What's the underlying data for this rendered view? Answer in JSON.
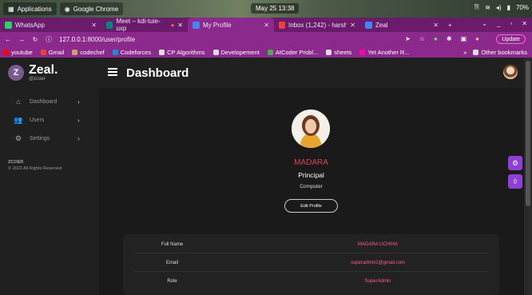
{
  "os": {
    "applications_label": "Applications",
    "chrome_label": "Google Chrome",
    "clock": "May 25  13:38",
    "battery": "70%"
  },
  "tabs": [
    {
      "label": "WhatsApp",
      "color": "#25d366"
    },
    {
      "label": "Meet – kdi-tuie-uxp",
      "color": "#00897b"
    },
    {
      "label": "My Profile",
      "color": "#4285f4",
      "active": true
    },
    {
      "label": "Inbox (1,242) - harshsh",
      "color": "#ea4335"
    },
    {
      "label": "Zeal",
      "color": "#4285f4"
    }
  ],
  "address": {
    "host": "127.0.0.1:",
    "rest": "8000/user/profile",
    "update_label": "Update"
  },
  "bookmarks": [
    {
      "label": "youtube",
      "color": "#ff0000"
    },
    {
      "label": "Gmail",
      "color": "#ea4335"
    },
    {
      "label": "codechef",
      "color": "#5b4638"
    },
    {
      "label": "Codeforces",
      "color": "#1f8acb"
    },
    {
      "label": "CP Algorithms",
      "color": "#cccccc"
    },
    {
      "label": "Developement",
      "color": "#cccccc"
    },
    {
      "label": "AtCoder Probl...",
      "color": "#4caf50"
    },
    {
      "label": "sheets",
      "color": "#cccccc"
    },
    {
      "label": "Yet Another R...",
      "color": "#f0a"
    }
  ],
  "other_bookmarks": "Other bookmarks",
  "sidebar": {
    "brand": "Zeal.",
    "brand_sub": "@zcoer",
    "logo_letter": "Z",
    "items": [
      {
        "label": "Dashboard",
        "icon": "home-icon"
      },
      {
        "label": "Users",
        "icon": "users-icon"
      },
      {
        "label": "Settings",
        "icon": "settings-icon"
      }
    ],
    "footer_title": "ZCOER",
    "footer_text": "© 2022 All Rights Reserved"
  },
  "header": {
    "title": "Dashboard"
  },
  "profile": {
    "name": "MADARA",
    "role": "Principal",
    "dept": "Computer",
    "edit_label": "Edit Profile"
  },
  "details": [
    {
      "key": "Full Name",
      "value": "MADARA UCHIHA"
    },
    {
      "key": "Email",
      "value": "superadmin2@gmail.com"
    },
    {
      "key": "Role",
      "value": "SuperAdmin"
    }
  ],
  "colors": {
    "accent": "#e0405a",
    "float_button": "#8e3fd8",
    "browser": "#8b2a8c"
  }
}
